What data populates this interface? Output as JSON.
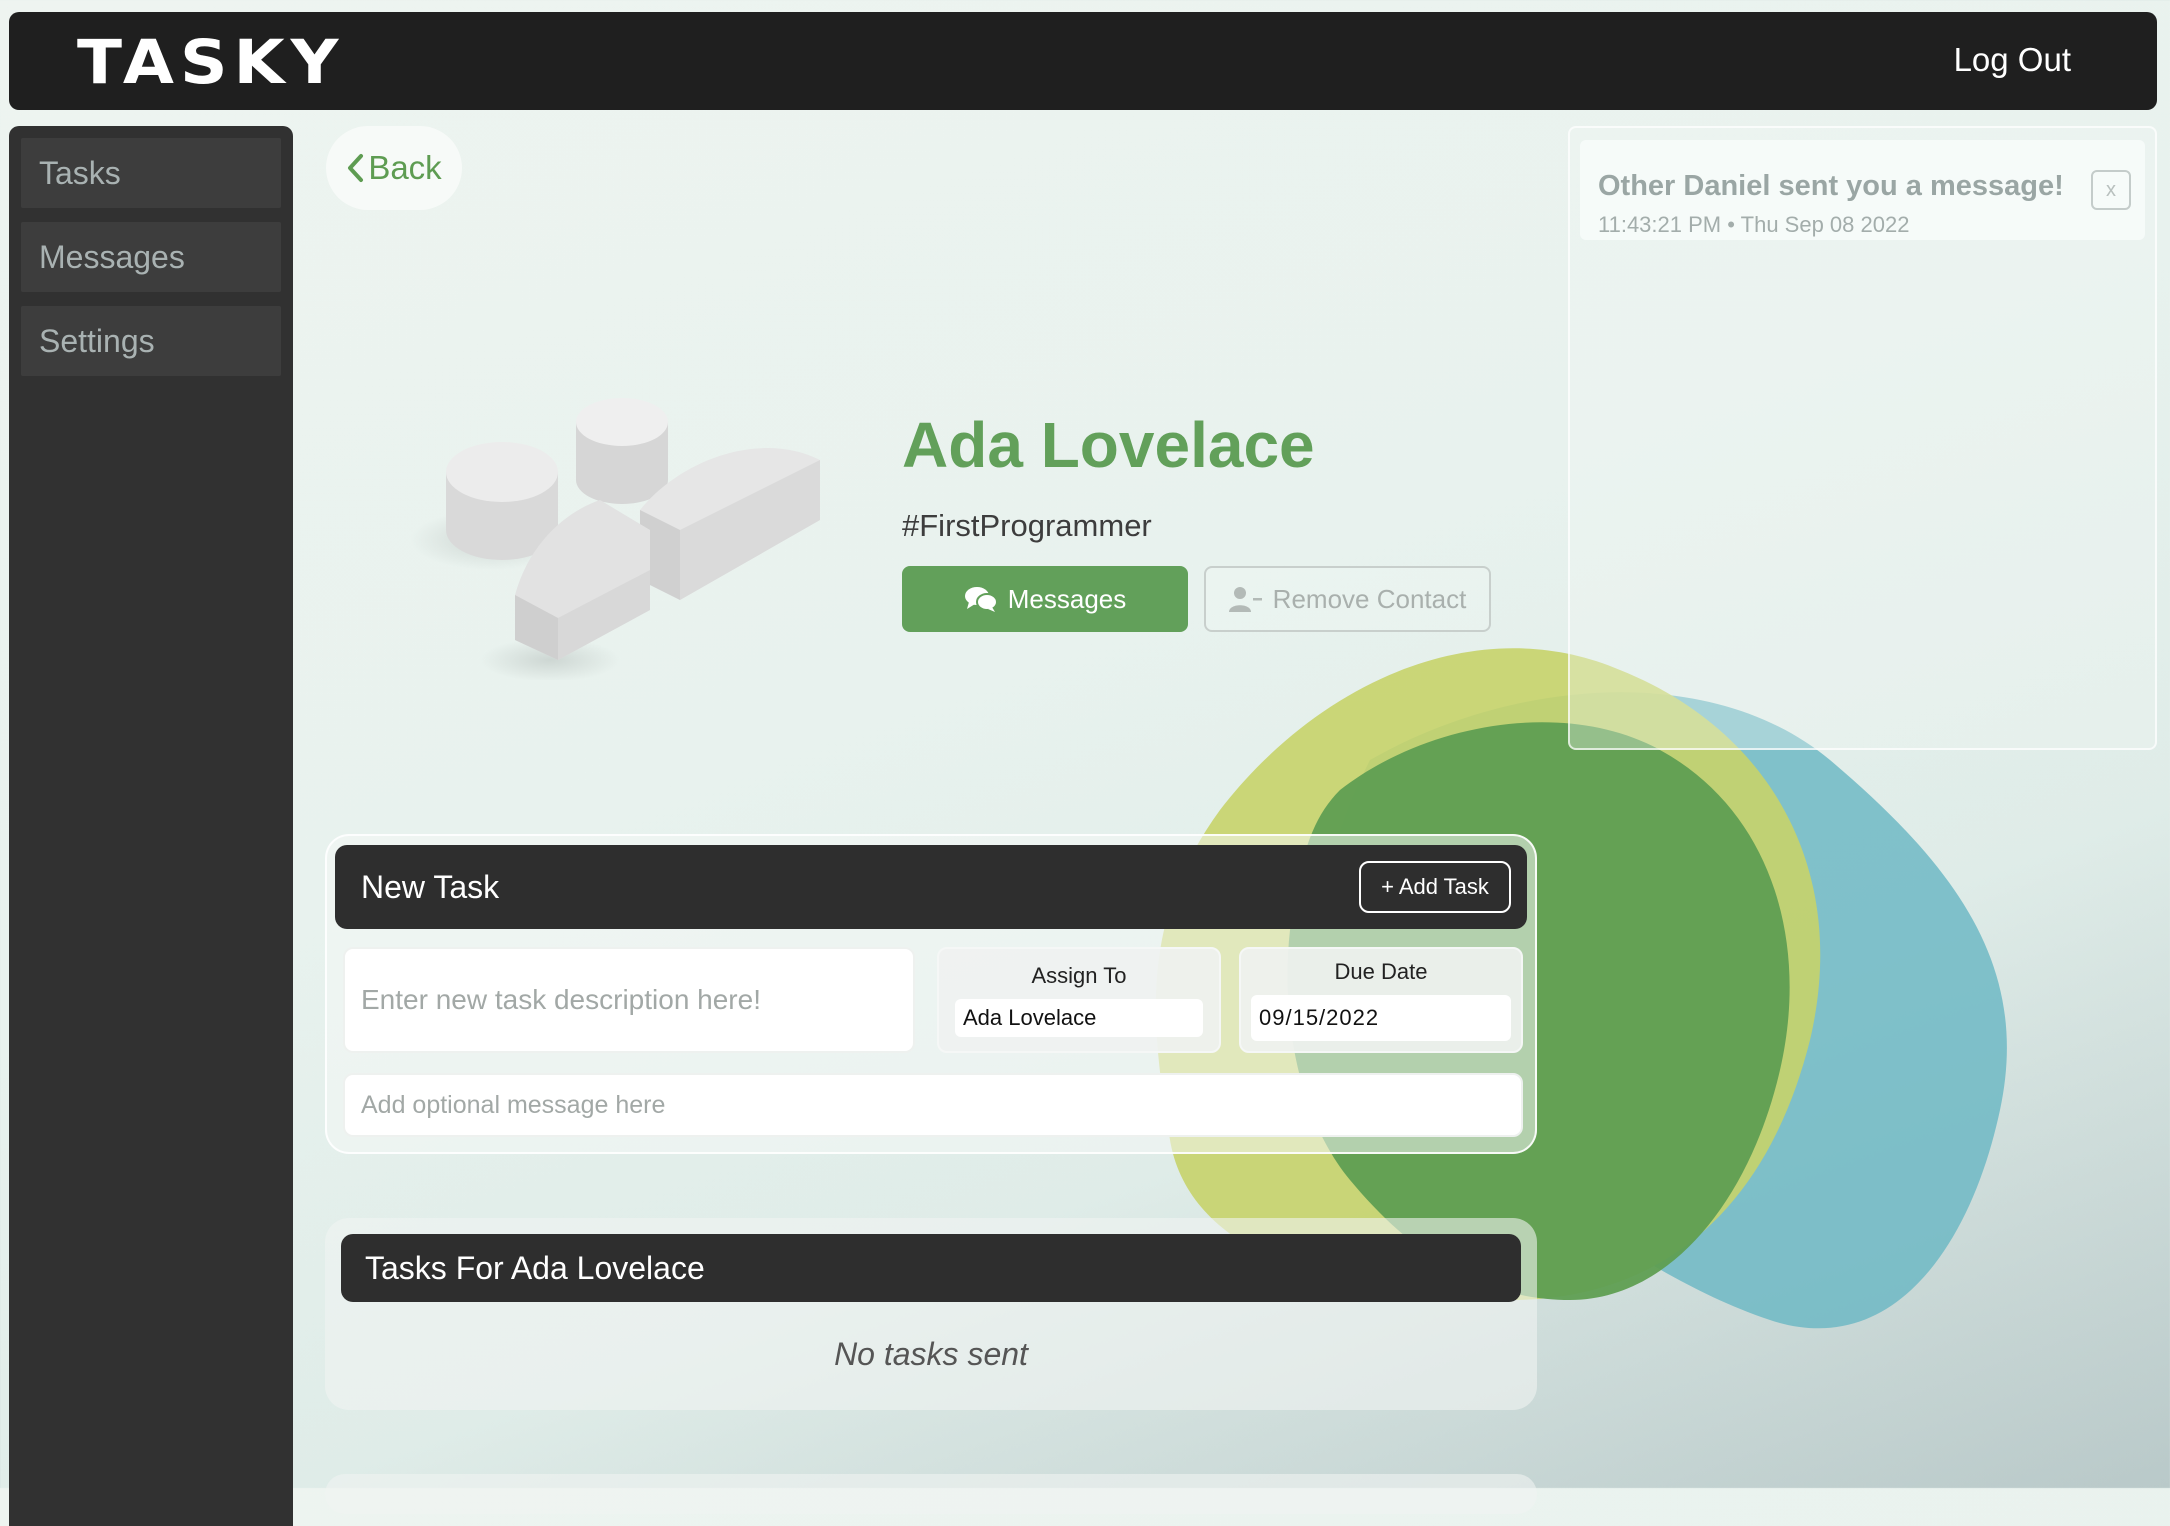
{
  "app": {
    "logo": "TASKY",
    "logout_label": "Log Out"
  },
  "sidebar": {
    "items": [
      {
        "label": "Tasks"
      },
      {
        "label": "Messages"
      },
      {
        "label": "Settings"
      }
    ]
  },
  "nav": {
    "back_label": "Back"
  },
  "profile": {
    "name": "Ada Lovelace",
    "handle": "#FirstProgrammer",
    "messages_label": "Messages",
    "remove_label": "Remove Contact"
  },
  "notification": {
    "title": "Other Daniel sent you a message!",
    "time": "11:43:21 PM • Thu Sep 08 2022",
    "close_label": "x"
  },
  "new_task": {
    "title": "New Task",
    "add_label": "+ Add Task",
    "description_placeholder": "Enter new task description here!",
    "assign_label": "Assign To",
    "assign_value": "Ada Lovelace",
    "due_label": "Due Date",
    "due_value": "09/15/2022",
    "message_placeholder": "Add optional message here"
  },
  "tasks_for": {
    "title": "Tasks For Ada Lovelace",
    "empty_text": "No tasks sent"
  },
  "colors": {
    "accent": "#62a05a",
    "dark": "#2e2e2e",
    "blob_lime": "#c7d36a",
    "blob_green": "#5f9e52",
    "blob_teal": "#6fb9c4"
  }
}
